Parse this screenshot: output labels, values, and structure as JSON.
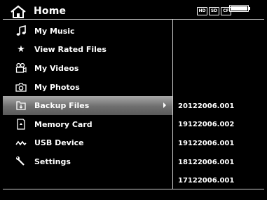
{
  "header": {
    "title": "Home",
    "status_icons": [
      {
        "name": "hdd-icon",
        "glyph": "HD"
      },
      {
        "name": "sd-card-icon",
        "glyph": "SD"
      },
      {
        "name": "cf-card-icon",
        "glyph": "CF"
      }
    ],
    "battery_level": 1.0
  },
  "menu": {
    "items": [
      {
        "label": "My Music",
        "icon": "music-note-icon",
        "glyph": "♫"
      },
      {
        "label": "View Rated Files",
        "icon": "star-icon",
        "glyph": "★"
      },
      {
        "label": "My Videos",
        "icon": "video-camera-icon",
        "glyph": ""
      },
      {
        "label": "My Photos",
        "icon": "camera-icon",
        "glyph": ""
      },
      {
        "label": "Backup Files",
        "icon": "backup-files-icon",
        "glyph": "",
        "selected": true
      },
      {
        "label": "Memory Card",
        "icon": "memory-card-icon",
        "glyph": ""
      },
      {
        "label": "USB Device",
        "icon": "usb-icon",
        "glyph": ""
      },
      {
        "label": "Settings",
        "icon": "wrench-icon",
        "glyph": ""
      }
    ]
  },
  "backups": {
    "items": [
      "20122006.001",
      "19122006.002",
      "19122006.001",
      "18122006.001",
      "17122006.001"
    ]
  },
  "colors": {
    "background": "#000000",
    "text": "#ffffff",
    "selection": "#7a7a7a"
  }
}
